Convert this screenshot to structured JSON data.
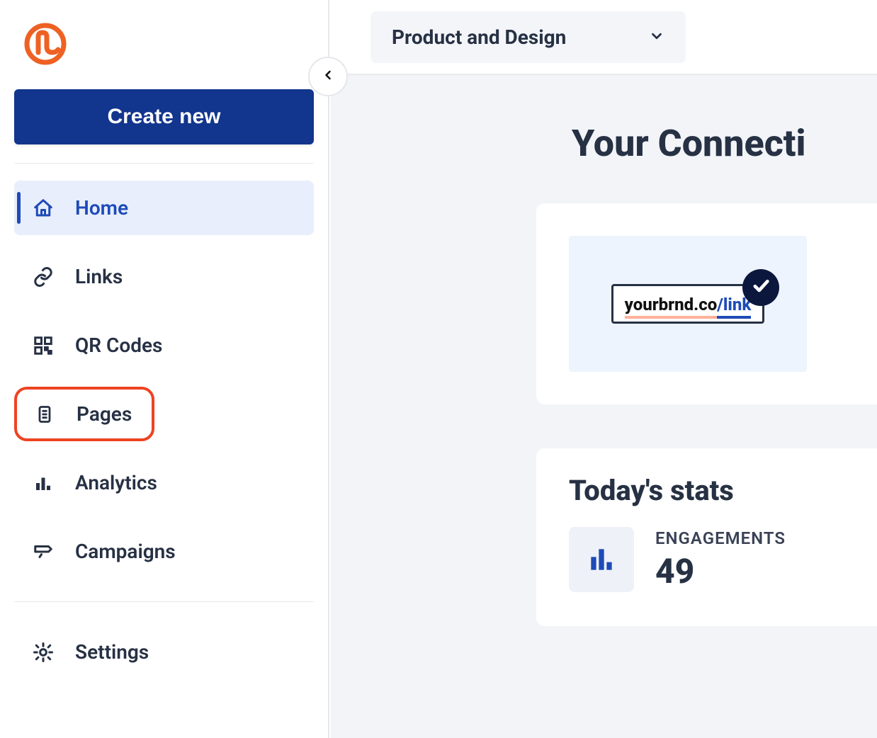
{
  "sidebar": {
    "create_label": "Create new",
    "items": [
      {
        "label": "Home"
      },
      {
        "label": "Links"
      },
      {
        "label": "QR Codes"
      },
      {
        "label": "Pages"
      },
      {
        "label": "Analytics"
      },
      {
        "label": "Campaigns"
      },
      {
        "label": "Settings"
      }
    ]
  },
  "topbar": {
    "workspace": "Product and Design"
  },
  "main": {
    "title": "Your Connecti",
    "brand_link_host": "yourbrnd.co",
    "brand_link_path": "/link",
    "stats_title": "Today's stats",
    "engagements_label": "ENGAGEMENTS",
    "engagements_value": "49"
  }
}
